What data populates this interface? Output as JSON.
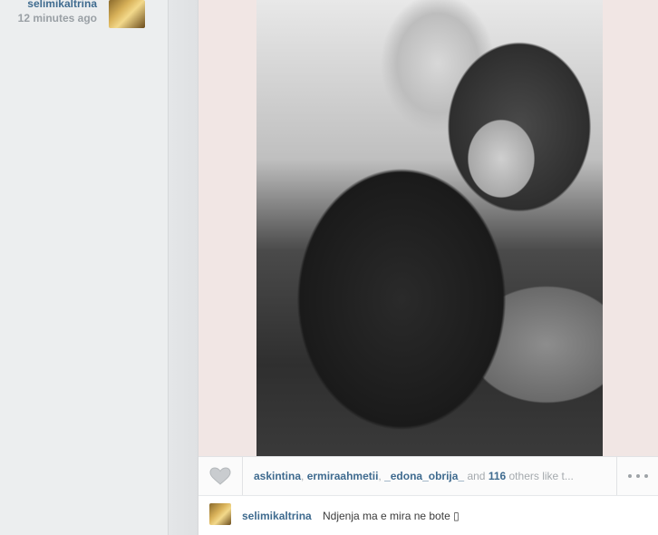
{
  "feed_item": {
    "username": "selimikaltrina",
    "timestamp": "12 minutes ago"
  },
  "post": {
    "likes": {
      "likers": [
        "askintina",
        "ermiraahmetii",
        "_edona_obrija_"
      ],
      "separator": ", ",
      "conjunction": " and ",
      "count": "116",
      "suffix": " others like t..."
    },
    "caption": {
      "username": "selimikaltrina",
      "text": "Ndjenja ma e mira ne bote ▯"
    }
  },
  "icons": {
    "like": "heart-icon",
    "more": "more-options-icon"
  },
  "colors": {
    "link": "#3f6b8f",
    "muted": "#a5aaae"
  }
}
